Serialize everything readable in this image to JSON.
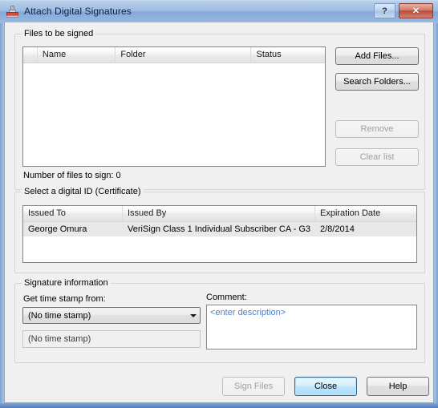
{
  "window": {
    "title": "Attach Digital Signatures",
    "icon": "stamp-icon",
    "help_button_label": "?",
    "close_button_label": "✕"
  },
  "files_group": {
    "legend": "Files to be signed",
    "columns": [
      "",
      "Name",
      "Folder",
      "Status"
    ],
    "rows": [],
    "count_label": "Number of files to sign: 0",
    "buttons": {
      "add_files": "Add Files...",
      "search_folders": "Search Folders...",
      "remove": "Remove",
      "clear_list": "Clear list"
    }
  },
  "certificate_group": {
    "legend": "Select a digital ID (Certificate)",
    "columns": [
      "Issued To",
      "Issued By",
      "Expiration Date"
    ],
    "rows": [
      {
        "issued_to": "George Omura",
        "issued_by": "VeriSign Class 1 Individual Subscriber CA - G3",
        "expiration_date": "2/8/2014"
      }
    ]
  },
  "signature_group": {
    "legend": "Signature information",
    "timestamp_label": "Get time stamp from:",
    "timestamp_selected": "(No time stamp)",
    "timestamp_options": [
      "(No time stamp)"
    ],
    "timestamp_detail": "(No time stamp)",
    "comment_label": "Comment:",
    "comment_placeholder": "<enter description>",
    "comment_value": ""
  },
  "footer": {
    "sign_files": "Sign Files",
    "close": "Close",
    "help": "Help"
  },
  "colors": {
    "title_accent": "#84a8d8",
    "close_accent": "#b84d3c",
    "default_button_accent": "#2c628b",
    "placeholder_blue": "#4a7fd0",
    "dialog_background": "#f0f0f0"
  }
}
